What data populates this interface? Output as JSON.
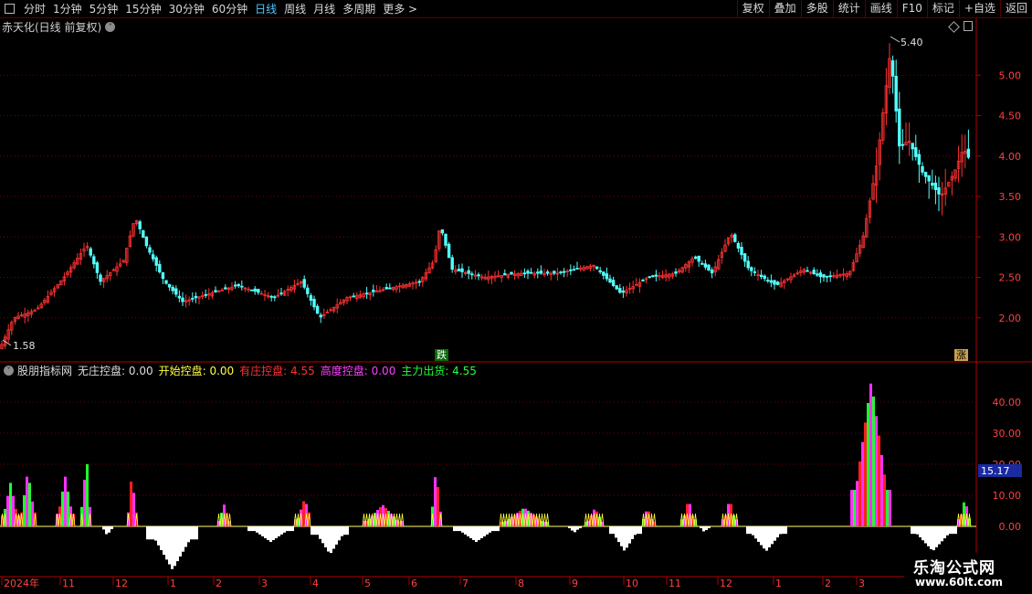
{
  "toolbar": {
    "periods": [
      "分时",
      "1分钟",
      "5分钟",
      "15分钟",
      "30分钟",
      "60分钟",
      "日线",
      "周线",
      "月线",
      "多周期",
      "更多 >"
    ],
    "active_period": "日线",
    "right_buttons": [
      "复权",
      "叠加",
      "多股",
      "统计",
      "画线",
      "F10",
      "标记",
      "+自选",
      "返回"
    ]
  },
  "main_panel": {
    "title": "赤天化(日线 前复权)",
    "price_axis": [
      "5.00",
      "4.50",
      "4.00",
      "3.50",
      "3.00",
      "2.50",
      "2.00"
    ],
    "high_label": "5.40",
    "low_label": "1.58",
    "tag_die": "跌",
    "tag_zhang": "涨"
  },
  "indicator": {
    "name": "股朋指标网",
    "items": [
      {
        "label": "无庄控盘:",
        "value": "0.00",
        "color": "#dcdcdc"
      },
      {
        "label": "开始控盘:",
        "value": "0.00",
        "color": "#ffff40"
      },
      {
        "label": "有庄控盘:",
        "value": "4.55",
        "color": "#ff3030"
      },
      {
        "label": "高度控盘:",
        "value": "0.00",
        "color": "#ff40ff"
      },
      {
        "label": "主力出货:",
        "value": "4.55",
        "color": "#20ff40"
      }
    ],
    "axis": [
      "40.00",
      "30.00",
      "20.00",
      "10.00",
      "0.00"
    ],
    "current_value": "15.17"
  },
  "time_axis": [
    "2024年",
    "11",
    "12",
    "1",
    "2",
    "3",
    "4",
    "5",
    "6",
    "7",
    "8",
    "9",
    "10",
    "11",
    "12",
    "1",
    "2",
    "3"
  ],
  "watermark": {
    "line1": "乐淘公式网",
    "line2": "www.60lt.com"
  },
  "colors": {
    "up": "#ff3232",
    "down": "#54ffff",
    "grid": "#7a0000",
    "axis": "#b00000",
    "magenta": "#ff30ff",
    "green": "#20ff30",
    "red": "#ff2020",
    "white": "#ffffff",
    "yellow": "#ffff40"
  },
  "chart_data": {
    "type": "candlestick",
    "ylim": [
      1.5,
      5.5
    ],
    "approx_close_path": [
      [
        0,
        1.62
      ],
      [
        15,
        2.0
      ],
      [
        40,
        2.1
      ],
      [
        70,
        2.5
      ],
      [
        95,
        2.9
      ],
      [
        110,
        2.45
      ],
      [
        135,
        2.7
      ],
      [
        148,
        3.25
      ],
      [
        160,
        2.9
      ],
      [
        180,
        2.45
      ],
      [
        200,
        2.2
      ],
      [
        230,
        2.3
      ],
      [
        260,
        2.4
      ],
      [
        300,
        2.25
      ],
      [
        330,
        2.45
      ],
      [
        350,
        2.0
      ],
      [
        380,
        2.25
      ],
      [
        420,
        2.35
      ],
      [
        460,
        2.45
      ],
      [
        475,
        2.7
      ],
      [
        482,
        3.15
      ],
      [
        495,
        2.6
      ],
      [
        530,
        2.5
      ],
      [
        570,
        2.55
      ],
      [
        610,
        2.55
      ],
      [
        650,
        2.65
      ],
      [
        680,
        2.3
      ],
      [
        710,
        2.5
      ],
      [
        740,
        2.55
      ],
      [
        760,
        2.75
      ],
      [
        780,
        2.55
      ],
      [
        800,
        3.05
      ],
      [
        820,
        2.6
      ],
      [
        850,
        2.4
      ],
      [
        880,
        2.6
      ],
      [
        900,
        2.5
      ],
      [
        930,
        2.55
      ],
      [
        945,
        3.0
      ],
      [
        960,
        3.9
      ],
      [
        975,
        5.3
      ],
      [
        985,
        4.1
      ],
      [
        995,
        4.2
      ],
      [
        1010,
        3.8
      ],
      [
        1030,
        3.5
      ],
      [
        1045,
        3.8
      ],
      [
        1055,
        4.1
      ],
      [
        1062,
        3.95
      ]
    ]
  }
}
